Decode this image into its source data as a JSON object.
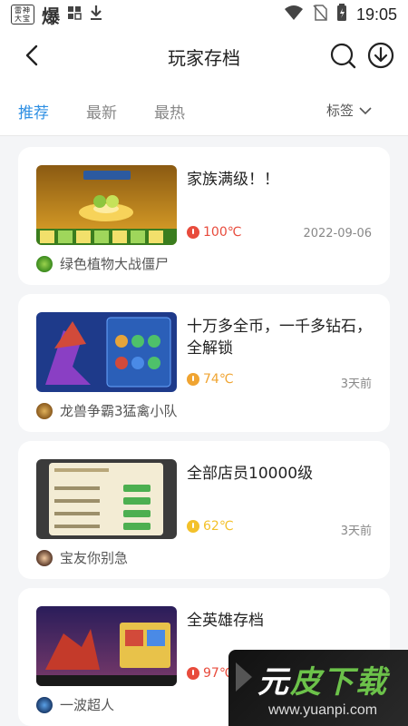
{
  "status_bar": {
    "app_badge": "雷神大宝",
    "glyph": "爆",
    "time": "19:05"
  },
  "app_bar": {
    "title": "玩家存档"
  },
  "tabs": {
    "items": [
      "推荐",
      "最新",
      "最热"
    ],
    "active": "推荐",
    "tag_filter": "标签"
  },
  "cards": [
    {
      "title": "家族满级！！",
      "heat": "100℃",
      "heat_color": "#e84b3c",
      "date": "2022-09-06",
      "game": "绿色植物大战僵尸"
    },
    {
      "title": "十万多全币，一千多钻石，全解锁",
      "heat": "74℃",
      "heat_color": "#f0a431",
      "date": "3天前",
      "game": "龙兽争霸3猛禽小队"
    },
    {
      "title": "全部店员10000级",
      "heat": "62℃",
      "heat_color": "#f3c12a",
      "date": "3天前",
      "game": "宝友你别急"
    },
    {
      "title": "全英雄存档",
      "heat": "97℃",
      "heat_color": "#e84b3c",
      "date": "",
      "game": "一波超人"
    }
  ],
  "watermark": {
    "main_white": "元",
    "main_green": "皮下载",
    "url": "www.yuanpi.com"
  },
  "colors": {
    "accent": "#2e8fe3"
  }
}
